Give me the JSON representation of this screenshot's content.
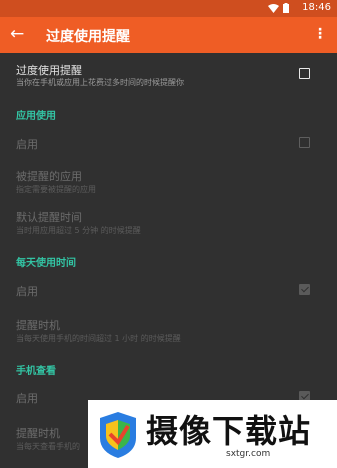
{
  "status_bar": {
    "time": "18:46",
    "icons": [
      "wifi-icon",
      "battery-icon"
    ]
  },
  "app_bar": {
    "title": "过度使用提醒",
    "back_icon": "arrow-left-icon",
    "menu_icon": "more-vert-icon"
  },
  "main_setting": {
    "title": "过度使用提醒",
    "summary": "当你在手机或应用上花费过多时间的时候提醒你",
    "checked": false
  },
  "sections": [
    {
      "header": "应用使用",
      "items": [
        {
          "title": "启用",
          "checkbox": true,
          "checked": false,
          "enabled": false
        },
        {
          "title": "被提醒的应用",
          "summary": "指定需要被提醒的应用",
          "enabled": false
        },
        {
          "title": "默认提醒时间",
          "summary": "当时用应用超过 5 分钟 的时候提醒",
          "enabled": false
        }
      ]
    },
    {
      "header": "每天使用时间",
      "items": [
        {
          "title": "启用",
          "checkbox": true,
          "checked": true,
          "enabled": false
        },
        {
          "title": "提醒时机",
          "summary": "当每天使用手机的时间超过 1 小时 的时候提醒",
          "enabled": false
        }
      ]
    },
    {
      "header": "手机查看",
      "items": [
        {
          "title": "启用",
          "checkbox": true,
          "checked": true,
          "enabled": false
        },
        {
          "title": "提醒时机",
          "summary": "当每天查看手机的",
          "enabled": false
        }
      ]
    }
  ],
  "watermark": {
    "text": "摄像下载站",
    "url": "sxtgr.com",
    "colors": [
      "#2a7de1",
      "#f7c21c",
      "#e8432d",
      "#3bb54a"
    ]
  },
  "colors": {
    "app_bar": "#ef5d25",
    "status_bar": "#cf4e1f",
    "accent": "#33c4a4",
    "background": "#303030"
  }
}
